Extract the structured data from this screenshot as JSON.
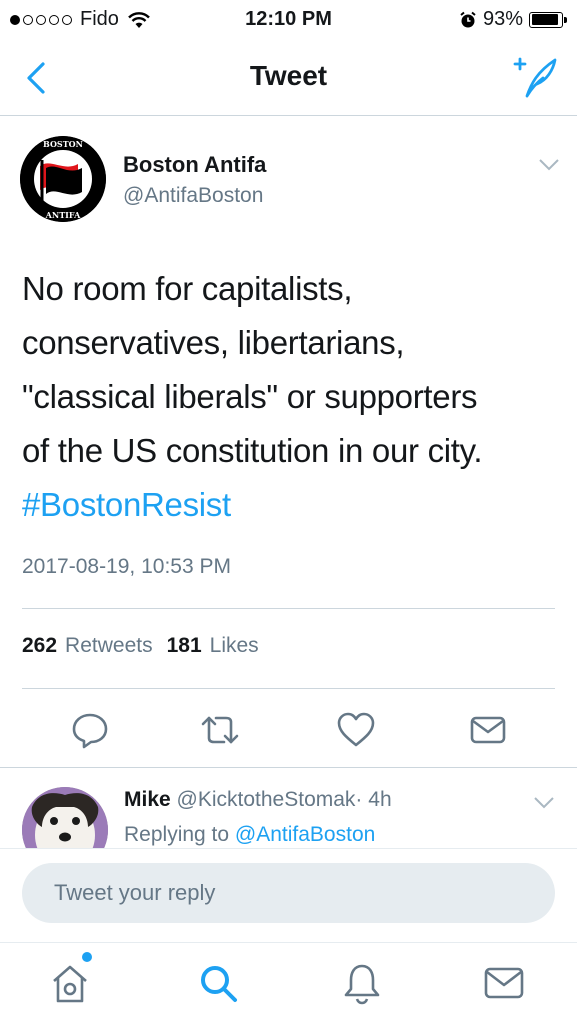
{
  "status_bar": {
    "carrier": "Fido",
    "time": "12:10 PM",
    "battery": "93%",
    "battery_level": 0.93,
    "signal_bars_filled": 1,
    "signal_bars_total": 5
  },
  "nav": {
    "title": "Tweet",
    "back_icon": "chevron-left-icon",
    "compose_icon": "compose-tweet-icon"
  },
  "tweet": {
    "author_name": "Boston Antifa",
    "author_handle": "@AntifaBoston",
    "avatar_text_top": "BOSTON",
    "avatar_text_bottom": "ANTIFA",
    "text_lines": [
      "No room for capitalists,",
      "conservatives, libertarians,",
      "\"classical liberals\" or supporters",
      "of the US constitution in our city."
    ],
    "hashtag": "#BostonResist",
    "timestamp": "2017-08-19, 10:53 PM",
    "retweets_count": "262",
    "retweets_label": "Retweets",
    "likes_count": "181",
    "likes_label": "Likes"
  },
  "reply": {
    "name": "Mike",
    "handle": "@KicktotheStomak",
    "separator": "·",
    "age": "4h",
    "replying_prefix": "Replying to",
    "replying_to": "@AntifaBoston"
  },
  "composer": {
    "placeholder": "Tweet your reply"
  },
  "colors": {
    "accent": "#1da1f2",
    "muted": "#657786",
    "border": "#ccd6dd",
    "flag_red": "#e0151b"
  }
}
